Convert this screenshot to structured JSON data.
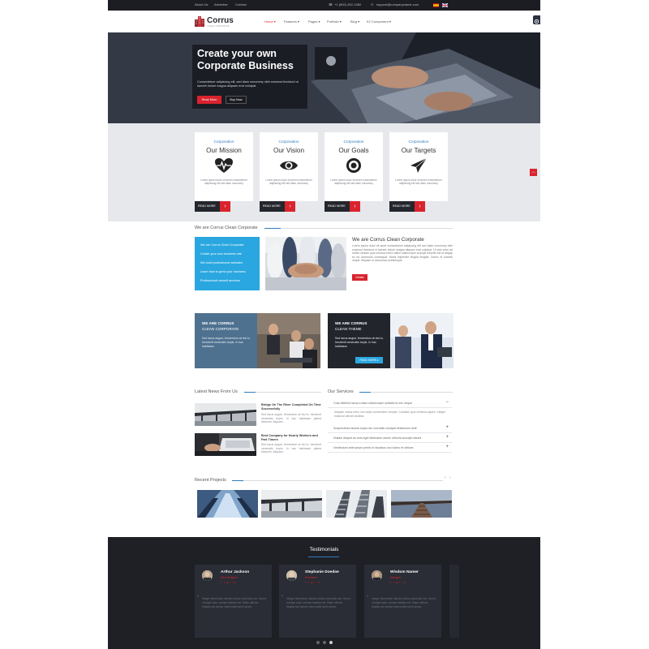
{
  "topbar": {
    "links": [
      "About Us",
      "Advertise",
      "Contact"
    ],
    "phone": "+1 (800) 452-1360",
    "email": "support@companyname.com"
  },
  "header": {
    "logo": "Corrus",
    "tagline": "CLEAN CORPORATE",
    "nav": [
      {
        "label": "Home",
        "chevron": "▾",
        "active": true
      },
      {
        "label": "Features",
        "chevron": "▾",
        "active": false
      },
      {
        "label": "Pages",
        "chevron": "▾",
        "active": false
      },
      {
        "label": "Portfolio",
        "chevron": "▾",
        "active": false
      },
      {
        "label": "Blog",
        "chevron": "▾",
        "active": false
      },
      {
        "label": "K2 Component",
        "chevron": "▾",
        "active": false
      }
    ],
    "accent_color": "#e02a33"
  },
  "hero": {
    "title_line1": "Create your own",
    "title_line2": "Corporate Business",
    "description": "Consectetuer adipiscing elit, sed diam nonummy nibh euismod tincidunt ut laoreet dolore magna aliquam erat volutpat.",
    "primary_button": "Read More",
    "secondary_button": "Buy Now"
  },
  "cards": [
    {
      "kicker": "Corporation",
      "title": "Our Mission",
      "icon": "heartbeat-icon",
      "text": "Lorem ipsum dolor sit amet consectetuer adipiscing elit sed diam nonummy",
      "button": "READ MORE"
    },
    {
      "kicker": "Corporation",
      "title": "Our Vision",
      "icon": "eye-icon",
      "text": "Lorem ipsum dolor sit amet consectetuer adipiscing elit sed diam nonummy",
      "button": "READ MORE"
    },
    {
      "kicker": "Corporation",
      "title": "Our Goals",
      "icon": "target-icon",
      "text": "Lorem ipsum dolor sit amet consectetuer adipiscing elit sed diam nonummy",
      "button": "READ MORE"
    },
    {
      "kicker": "Corporation",
      "title": "Our Targets",
      "icon": "paper-plane-icon",
      "text": "Lorem ipsum dolor sit amet consectetuer adipiscing elit sed diam nonummy",
      "button": "READ MORE"
    }
  ],
  "about": {
    "section_title": "We are Corrus Clean Corporate",
    "list": [
      "We are Corrus Clean Corporate",
      "Create your own business site",
      "We build professional websites",
      "Learn how to grow your business",
      "Professional consult services"
    ],
    "heading": "We are Corrus Clean Corporate",
    "text": "Lorem ipsum dolor sit amet consectetuer adipiscing elit sed diam nonummy nibh euismod tincidunt ut laoreet dolore magna aliquam erat volutpat. Ut wisi enim ad minim veniam quis nostrud exerci tation ullamcorper suscipit lobortis nisl ut aliquip ex ea commodo consequat. Morbi imperdiet feugiat fringilla. Donec et lobortis neque. Aliquam ut accumsan scelerisque.",
    "button": "Details"
  },
  "promos": [
    {
      "line1": "WE ARE CORRUS",
      "line2": "CLEAN CORPORATE",
      "text": "Sed lacus augue, fermentum at nisi in, hendrerit venenatis turpis. In hac habitasse"
    },
    {
      "line1": "WE ARE CORRUS",
      "line2": "CLEAN THEME",
      "text": "Sed lacus augue, fermentum at nisi in, hendrerit venenatis turpis. In hac habitasse",
      "button": "READ MORE ▸"
    }
  ],
  "news": {
    "section_title": "Latest News From Us",
    "items": [
      {
        "title": "Bridge On The River Completed On Time Successfully",
        "text": "Sed lacus augue, fermentum at nisi in, hendrerit venenatis turpis. In hac habitasse platea dictumst. Aliquam."
      },
      {
        "title": "Best Company for Hourly Workers and Part Timers",
        "text": "Sed lacus augue, fermentum at nisi in, hendrerit venenatis turpis. In hac habitasse platea dictumst. Aliquam."
      }
    ]
  },
  "services": {
    "section_title": "Our Services",
    "open_question": "Cras eleifend lacus a diam ullamcorper sodales id nec neque",
    "open_answer": "Aliquam varius tortor non turpis consectetur semper. Curabitur quis vehicula sapien. Integer euismod ultrices facilisis.",
    "questions": [
      "Suspendisse lacinia turpis nec convallis volutpat vestibulum ante",
      "Nullam aliquet ac eros eget bibendum donec ultrices suscipit mauris",
      "Vestibulum ante ipsum primis in faucibus orci luctus et ultrices"
    ]
  },
  "projects": {
    "section_title": "Recent Projects"
  },
  "testimonials": {
    "title": "Testimonials",
    "items": [
      {
        "name": "Arthur Jackson",
        "role": "Web Designer",
        "social": "f t g+ in",
        "quote": "Integer fermentum ultricies metus commodo nec. Sed ut volutpat dolor, semper facilisis nisi. Etiam ultrices fringilla sed lacinia nulla mattis lorem ipsum."
      },
      {
        "name": "Stephanie Doedoe",
        "role": "Developer",
        "social": "f t g+ in",
        "quote": "Integer fermentum ultricies metus commodo nec. Sed ut volutpat dolor, semper facilisis nisi. Etiam ultrices fringilla sed lacinia nulla mattis lorem ipsum."
      },
      {
        "name": "Wisdom Namer",
        "role": "Manager",
        "social": "f t g+ in",
        "quote": "Integer fermentum ultricies metus commodo nec. Sed ut volutpat dolor, semper facilisis nisi. Etiam ultrices fringilla sed lacinia nulla mattis lorem ipsum."
      }
    ],
    "active_dot": 3
  }
}
